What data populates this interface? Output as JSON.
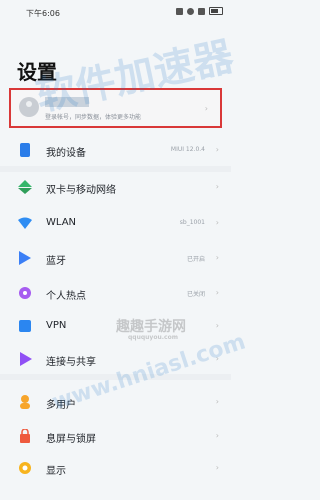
{
  "status_bar": {
    "time": "下午6:06"
  },
  "page": {
    "title": "设置"
  },
  "account": {
    "hint": "登录帐号，同步数据，体验更多功能"
  },
  "menu": [
    {
      "label": "我的设备",
      "value": "MIUI 12.0.4",
      "icon": "device-icon",
      "color": "#2b7de9"
    },
    {
      "label": "双卡与移动网络",
      "value": "",
      "icon": "sim-network-icon",
      "color": "#35b66a"
    },
    {
      "label": "WLAN",
      "value": "sb_1001",
      "icon": "wifi-icon",
      "color": "#2f8df3"
    },
    {
      "label": "蓝牙",
      "value": "已开启",
      "icon": "bluetooth-icon",
      "color": "#3b7ff6"
    },
    {
      "label": "个人热点",
      "value": "已关闭",
      "icon": "hotspot-icon",
      "color": "#a65cf0"
    },
    {
      "label": "VPN",
      "value": "",
      "icon": "vpn-icon",
      "color": "#2b86f0"
    },
    {
      "label": "连接与共享",
      "value": "",
      "icon": "share-connect-icon",
      "color": "#9050f5"
    },
    {
      "label": "多用户",
      "value": "",
      "icon": "multi-user-icon",
      "color": "#f7a52b"
    },
    {
      "label": "息屏与锁屏",
      "value": "",
      "icon": "lock-screen-icon",
      "color": "#ee5a3e"
    },
    {
      "label": "显示",
      "value": "",
      "icon": "display-icon",
      "color": "#f7b41f"
    }
  ],
  "watermarks": {
    "main": "软件加速器",
    "site_name": "趣趣手游网",
    "domain": "qququyou.com",
    "url": "www.hniasl.com"
  }
}
